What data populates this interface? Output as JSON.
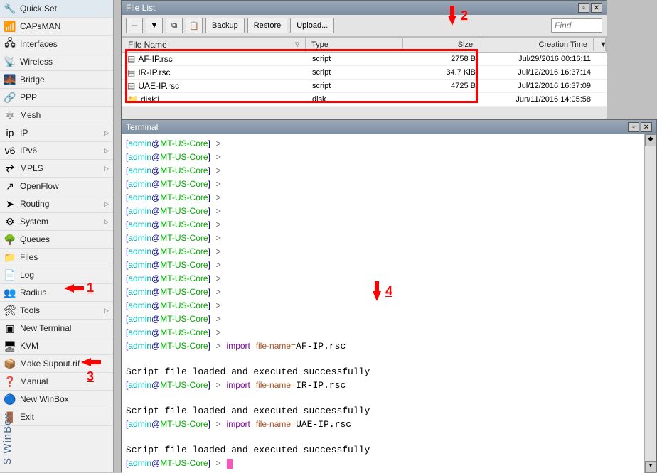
{
  "app_label": "S WinBox",
  "menu": [
    {
      "icon": "🔧",
      "label": "Quick Set",
      "arrow": false
    },
    {
      "icon": "📶",
      "label": "CAPsMAN",
      "arrow": false
    },
    {
      "icon": "🖧",
      "label": "Interfaces",
      "arrow": false
    },
    {
      "icon": "📡",
      "label": "Wireless",
      "arrow": false
    },
    {
      "icon": "🌉",
      "label": "Bridge",
      "arrow": false
    },
    {
      "icon": "🔗",
      "label": "PPP",
      "arrow": false
    },
    {
      "icon": "⚛",
      "label": "Mesh",
      "arrow": false
    },
    {
      "icon": "ip",
      "label": "IP",
      "arrow": true
    },
    {
      "icon": "v6",
      "label": "IPv6",
      "arrow": true
    },
    {
      "icon": "⇄",
      "label": "MPLS",
      "arrow": true
    },
    {
      "icon": "↗",
      "label": "OpenFlow",
      "arrow": false
    },
    {
      "icon": "➤",
      "label": "Routing",
      "arrow": true
    },
    {
      "icon": "⚙",
      "label": "System",
      "arrow": true
    },
    {
      "icon": "🌳",
      "label": "Queues",
      "arrow": false
    },
    {
      "icon": "📁",
      "label": "Files",
      "arrow": false
    },
    {
      "icon": "📄",
      "label": "Log",
      "arrow": false
    },
    {
      "icon": "👥",
      "label": "Radius",
      "arrow": false
    },
    {
      "icon": "🛠",
      "label": "Tools",
      "arrow": true
    },
    {
      "icon": "▣",
      "label": "New Terminal",
      "arrow": false
    },
    {
      "icon": "🖥",
      "label": "KVM",
      "arrow": false
    },
    {
      "icon": "📦",
      "label": "Make Supout.rif",
      "arrow": false
    },
    {
      "icon": "❓",
      "label": "Manual",
      "arrow": false
    },
    {
      "icon": "🔵",
      "label": "New WinBox",
      "arrow": false
    },
    {
      "icon": "🚪",
      "label": "Exit",
      "arrow": false
    }
  ],
  "file_window": {
    "title": "File List",
    "toolbar": {
      "minus": "–",
      "filter": "▼",
      "copy": "⧉",
      "paste": "📋",
      "backup": "Backup",
      "restore": "Restore",
      "upload": "Upload..."
    },
    "find_placeholder": "Find",
    "columns": {
      "name": "File Name",
      "type": "Type",
      "size": "Size",
      "ctime": "Creation Time"
    },
    "rows": [
      {
        "icon": "▤",
        "name": "AF-IP.rsc",
        "type": "script",
        "size": "2758 B",
        "ctime": "Jul/29/2016 00:16:11"
      },
      {
        "icon": "▤",
        "name": "IR-IP.rsc",
        "type": "script",
        "size": "34.7 KiB",
        "ctime": "Jul/12/2016 16:37:14"
      },
      {
        "icon": "▤",
        "name": "UAE-IP.rsc",
        "type": "script",
        "size": "4725 B",
        "ctime": "Jul/12/2016 16:37:09"
      },
      {
        "icon": "📁",
        "name": "disk1",
        "type": "disk",
        "size": "",
        "ctime": "Jun/11/2016 14:05:58"
      }
    ]
  },
  "terminal": {
    "title": "Terminal",
    "prompt_user": "admin",
    "prompt_at": "@",
    "prompt_host": "MT-US-Core",
    "gt": ">",
    "blank_count": 15,
    "imports": [
      {
        "cmd": "import",
        "key": "file-name=",
        "val": "AF-IP.rsc"
      },
      {
        "cmd": "import",
        "key": "file-name=",
        "val": "IR-IP.rsc"
      },
      {
        "cmd": "import",
        "key": "file-name=",
        "val": "UAE-IP.rsc"
      }
    ],
    "success_msg": "Script file loaded and executed successfully"
  },
  "annotations": {
    "a1": "1",
    "a2": "2",
    "a3": "3",
    "a4": "4"
  }
}
